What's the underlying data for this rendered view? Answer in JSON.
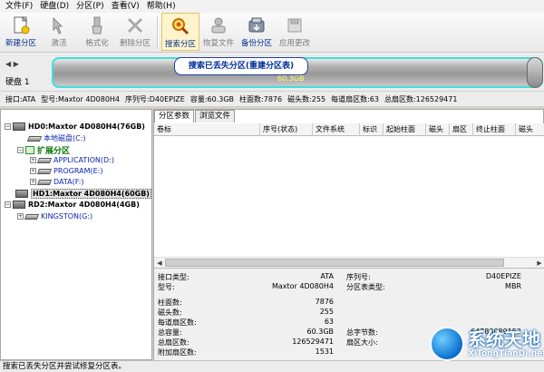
{
  "menu": [
    "文件(F)",
    "硬盘(D)",
    "分区(P)",
    "查看(V)",
    "帮助(H)"
  ],
  "toolbar": [
    {
      "label": "新建分区",
      "icon": "new-partition-icon",
      "state": "normal"
    },
    {
      "label": "激活",
      "icon": "activate-icon",
      "state": "disabled"
    },
    {
      "label": "格式化",
      "icon": "format-icon",
      "state": "disabled"
    },
    {
      "label": "删除分区",
      "icon": "delete-partition-icon",
      "state": "disabled"
    },
    {
      "label": "搜索分区",
      "icon": "search-partition-icon",
      "state": "active"
    },
    {
      "label": "恢复文件",
      "icon": "recover-files-icon",
      "state": "disabled"
    },
    {
      "label": "备份分区",
      "icon": "backup-partition-icon",
      "state": "normal"
    },
    {
      "label": "应用更改",
      "icon": "apply-changes-icon",
      "state": "disabled"
    }
  ],
  "diskmap": {
    "disk_label": "硬盘 1",
    "size": "60.3GB",
    "tooltip": "搜索已丢失分区(重建分区表)"
  },
  "diskinfo": {
    "interface": "接口:ATA",
    "model": "型号:Maxtor 4D080H4",
    "serial": "序列号:D40EPIZE",
    "capacity": "容量:60.3GB",
    "cylinders": "柱面数:7876",
    "heads": "磁头数:255",
    "sectors_per_track": "每道扇区数:63",
    "total_sectors": "总扇区数:126529471"
  },
  "tree": {
    "disks": [
      {
        "label": "HD0:Maxtor 4D080H4(76GB)",
        "selected": false,
        "partitions": [
          "本地磁盘(C:)"
        ],
        "extended": {
          "label": "扩展分区",
          "partitions": [
            "APPLICATION(D:)",
            "PROGRAM(E:)",
            "DATA(F:)"
          ]
        }
      },
      {
        "label": "HD1:Maxtor 4D080H4(60GB)",
        "selected": true
      },
      {
        "label": "RD2:Maxtor 4D080H4(4GB)",
        "selected": false,
        "partitions": [
          "KINGSTON(G:)"
        ]
      }
    ]
  },
  "tabs": [
    "分区参数",
    "浏览文件"
  ],
  "columns": [
    "卷标",
    "序号(状态)",
    "文件系统",
    "标识",
    "起始柱面",
    "磁头",
    "扇区",
    "终止柱面",
    "磁头"
  ],
  "props": {
    "interface_label": "接口类型:",
    "interface_value": "ATA",
    "serial_label": "序列号:",
    "serial_value": "D40EPIZE",
    "model_label": "型号:",
    "model_value": "Maxtor 4D080H4",
    "pt_type_label": "分区表类型:",
    "pt_type_value": "MBR",
    "cyl_label": "柱面数:",
    "cyl_value": "7876",
    "heads_label": "磁头数:",
    "heads_value": "255",
    "spt_label": "每道扇区数:",
    "spt_value": "63",
    "capacity_label": "总容量:",
    "capacity_value": "60.3GB",
    "total_bytes_label": "总字节数:",
    "total_bytes_value": "64783089152",
    "total_sectors_label": "总扇区数:",
    "total_sectors_value": "126529471",
    "sector_size_label": "扇区大小:",
    "sector_size_value": "",
    "extra_sectors_label": "附加扇区数:",
    "extra_sectors_value": "1531"
  },
  "status": "搜索已丢失分区并尝试修复分区表。",
  "watermark": {
    "brand": "系统天地",
    "url": "XiTongTianDi.net"
  },
  "colors": {
    "accent_blue": "#0a24b0",
    "extended_green": "#0c7a0c",
    "disk_border": "#3ee1d9"
  }
}
